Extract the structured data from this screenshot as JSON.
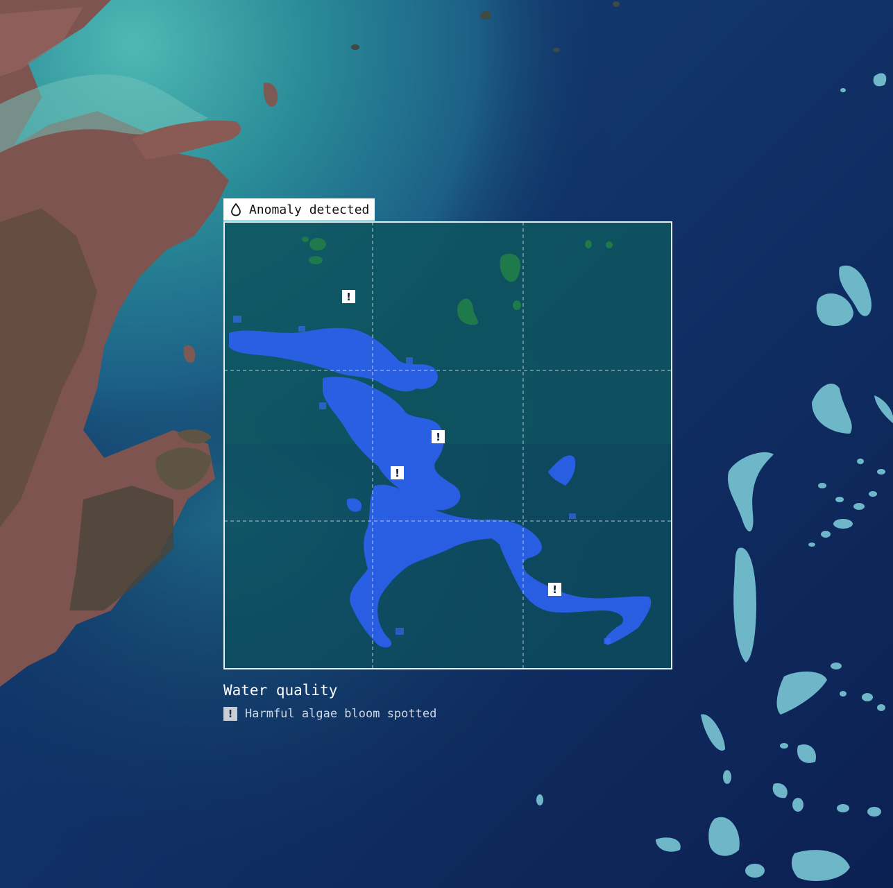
{
  "anomaly": {
    "label": "Anomaly detected",
    "icon": "water-drop-icon"
  },
  "markers": [
    {
      "name": "alert-marker-1",
      "symbol": "!"
    },
    {
      "name": "alert-marker-2",
      "symbol": "!"
    },
    {
      "name": "alert-marker-3",
      "symbol": "!"
    },
    {
      "name": "alert-marker-4",
      "symbol": "!"
    }
  ],
  "legend": {
    "title": "Water quality",
    "items": [
      {
        "symbol": "!",
        "label": "Harmful algae bloom spotted",
        "icon": "alert-icon"
      }
    ]
  },
  "colors": {
    "ocean_deep": "#0f2a5c",
    "ocean_shallow": "#2f9aa0",
    "land": "#8a5a55",
    "bloom": "#2f63ff",
    "reef": "#7fd0dc",
    "frame": "#e8eef5"
  }
}
